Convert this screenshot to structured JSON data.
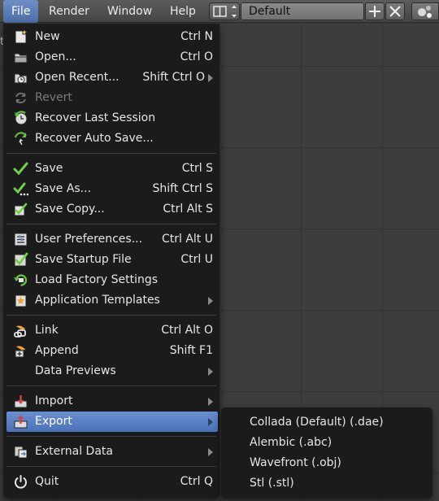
{
  "header": {
    "menus": [
      "File",
      "Render",
      "Window",
      "Help"
    ],
    "layout_name": "Default",
    "add_icon": "plus-icon",
    "remove_icon": "x-icon"
  },
  "background": {
    "edge_text": "t"
  },
  "file_menu": {
    "new": {
      "label": "New",
      "shortcut": "Ctrl N",
      "icon": "new-file-icon"
    },
    "open": {
      "label": "Open...",
      "shortcut": "Ctrl O",
      "icon": "folder-icon"
    },
    "open_recent": {
      "label": "Open Recent...",
      "shortcut": "Shift Ctrl O",
      "icon": "recent-folder-icon"
    },
    "revert": {
      "label": "Revert",
      "icon": "revert-icon"
    },
    "recover_last": {
      "label": "Recover Last Session",
      "icon": "recover-icon"
    },
    "recover_auto": {
      "label": "Recover Auto Save...",
      "icon": "recover-auto-icon"
    },
    "save": {
      "label": "Save",
      "shortcut": "Ctrl S",
      "icon": "checkmark-icon"
    },
    "save_as": {
      "label": "Save As...",
      "shortcut": "Shift Ctrl S",
      "icon": "checkmark-dots-icon"
    },
    "save_copy": {
      "label": "Save Copy...",
      "shortcut": "Ctrl Alt S",
      "icon": "save-copy-icon"
    },
    "user_prefs": {
      "label": "User Preferences...",
      "shortcut": "Ctrl Alt U",
      "icon": "preferences-icon"
    },
    "save_startup": {
      "label": "Save Startup File",
      "shortcut": "Ctrl U",
      "icon": "save-startup-icon"
    },
    "load_factory": {
      "label": "Load Factory Settings",
      "icon": "load-factory-icon"
    },
    "app_templates": {
      "label": "Application Templates",
      "icon": "templates-icon"
    },
    "link": {
      "label": "Link",
      "shortcut": "Ctrl Alt O",
      "icon": "link-icon"
    },
    "append": {
      "label": "Append",
      "shortcut": "Shift F1",
      "icon": "append-icon"
    },
    "data_previews": {
      "label": "Data Previews"
    },
    "import": {
      "label": "Import",
      "icon": "import-icon"
    },
    "export": {
      "label": "Export",
      "icon": "export-icon"
    },
    "external_data": {
      "label": "External Data",
      "icon": "external-data-icon"
    },
    "quit": {
      "label": "Quit",
      "shortcut": "Ctrl Q",
      "icon": "power-icon"
    }
  },
  "export_submenu": [
    "Collada (Default) (.dae)",
    "Alembic (.abc)",
    "Wavefront (.obj)",
    "Stl (.stl)"
  ],
  "colors": {
    "highlight": "#5a80c4",
    "menu_bg": "#1a1a1a",
    "header_bg": "#4f4f4f"
  }
}
